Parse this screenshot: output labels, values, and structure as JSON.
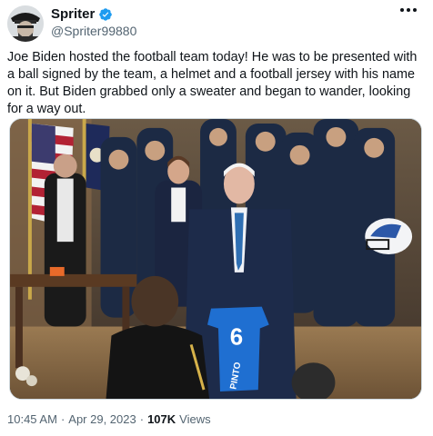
{
  "author": {
    "display_name": "Spriter",
    "handle": "@Spriter99880",
    "verified": true,
    "avatar_icon": "avatar-pirate-icon"
  },
  "menu_icon": "more-dots-icon",
  "tweet": {
    "text": "Joe Biden hosted the football team today! He was to be presented with a ball signed by the team, a helmet and a football jersey with his name on it. But Biden grabbed only a sweater and began to wander, looking for a way out."
  },
  "media": {
    "jersey_number": "6",
    "jersey_name": "PINTO"
  },
  "meta": {
    "time": "10:45 AM",
    "separator": "·",
    "date": "Apr 29, 2023",
    "views_count": "107K",
    "views_label": "Views"
  },
  "colors": {
    "verified_blue": "#1d9bf0",
    "text_primary": "#0f1419",
    "text_secondary": "#536471",
    "jersey_blue": "#1f6fd1"
  }
}
